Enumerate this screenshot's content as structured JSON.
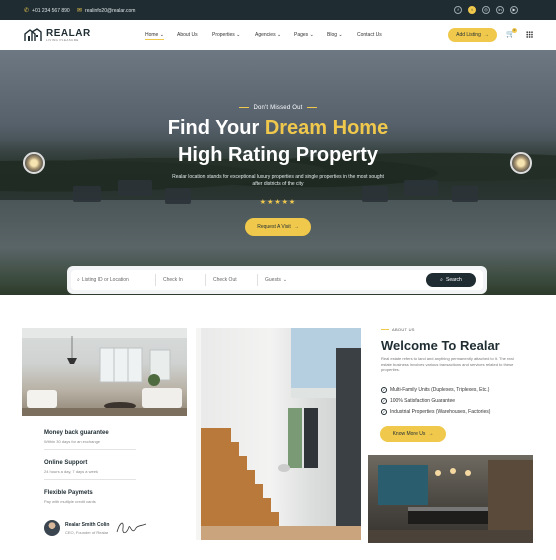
{
  "topbar": {
    "phone": "+01 234 567 890",
    "email": "realinfo20@realar.com",
    "socials": [
      "facebook-icon",
      "twitter-icon",
      "instagram-icon",
      "linkedin-icon",
      "youtube-icon"
    ]
  },
  "logo": {
    "name": "REALAR",
    "tagline": "LIVING PLEASURE"
  },
  "nav": {
    "items": [
      "Home",
      "About Us",
      "Properties",
      "Agencies",
      "Pages",
      "Blog",
      "Contact Us"
    ],
    "active_index": 0,
    "cta_label": "Add Listing",
    "cart_count": "0"
  },
  "hero": {
    "eyebrow": "Don't Missed Out",
    "title_line1_a": "Find Your ",
    "title_line1_b": "Dream Home",
    "title_line2": "High Rating Property",
    "subtitle": "Realar location stands for exceptional luxury properties and single properties in the most sought after districts of the city",
    "stars": "★★★★★",
    "button_label": "Request A Visit"
  },
  "search": {
    "listing_placeholder": "Listing ID or Location",
    "checkin_placeholder": "Check In",
    "checkout_placeholder": "Check Out",
    "guests_placeholder": "Guests",
    "button_label": "Search"
  },
  "features": [
    {
      "title": "Money back guarantee",
      "desc": "Within 30 days for an exchange"
    },
    {
      "title": "Online Support",
      "desc": "24 hours a day, 7 days a week"
    },
    {
      "title": "Flexible Paymets",
      "desc": "Pay with multiple credit cards"
    }
  ],
  "author": {
    "name": "Realar Smith Colin",
    "role": "CEO, Founder of Realar"
  },
  "about": {
    "tag": "ABOUT US",
    "title": "Welcome To Realar",
    "paragraph": "Real estate refers to land and anything permanently attached to it. The real estate business involves various transactions and services related to these properties.",
    "checks": [
      "Multi-Family Units (Duplexes, Triplexes, Etc.)",
      "100% Satisfaction Guarantee",
      "Industrial Properties (Warehouses, Factories)"
    ],
    "button_label": "Know More Us"
  },
  "colors": {
    "accent": "#f0c84c",
    "dark": "#1f2d33"
  }
}
